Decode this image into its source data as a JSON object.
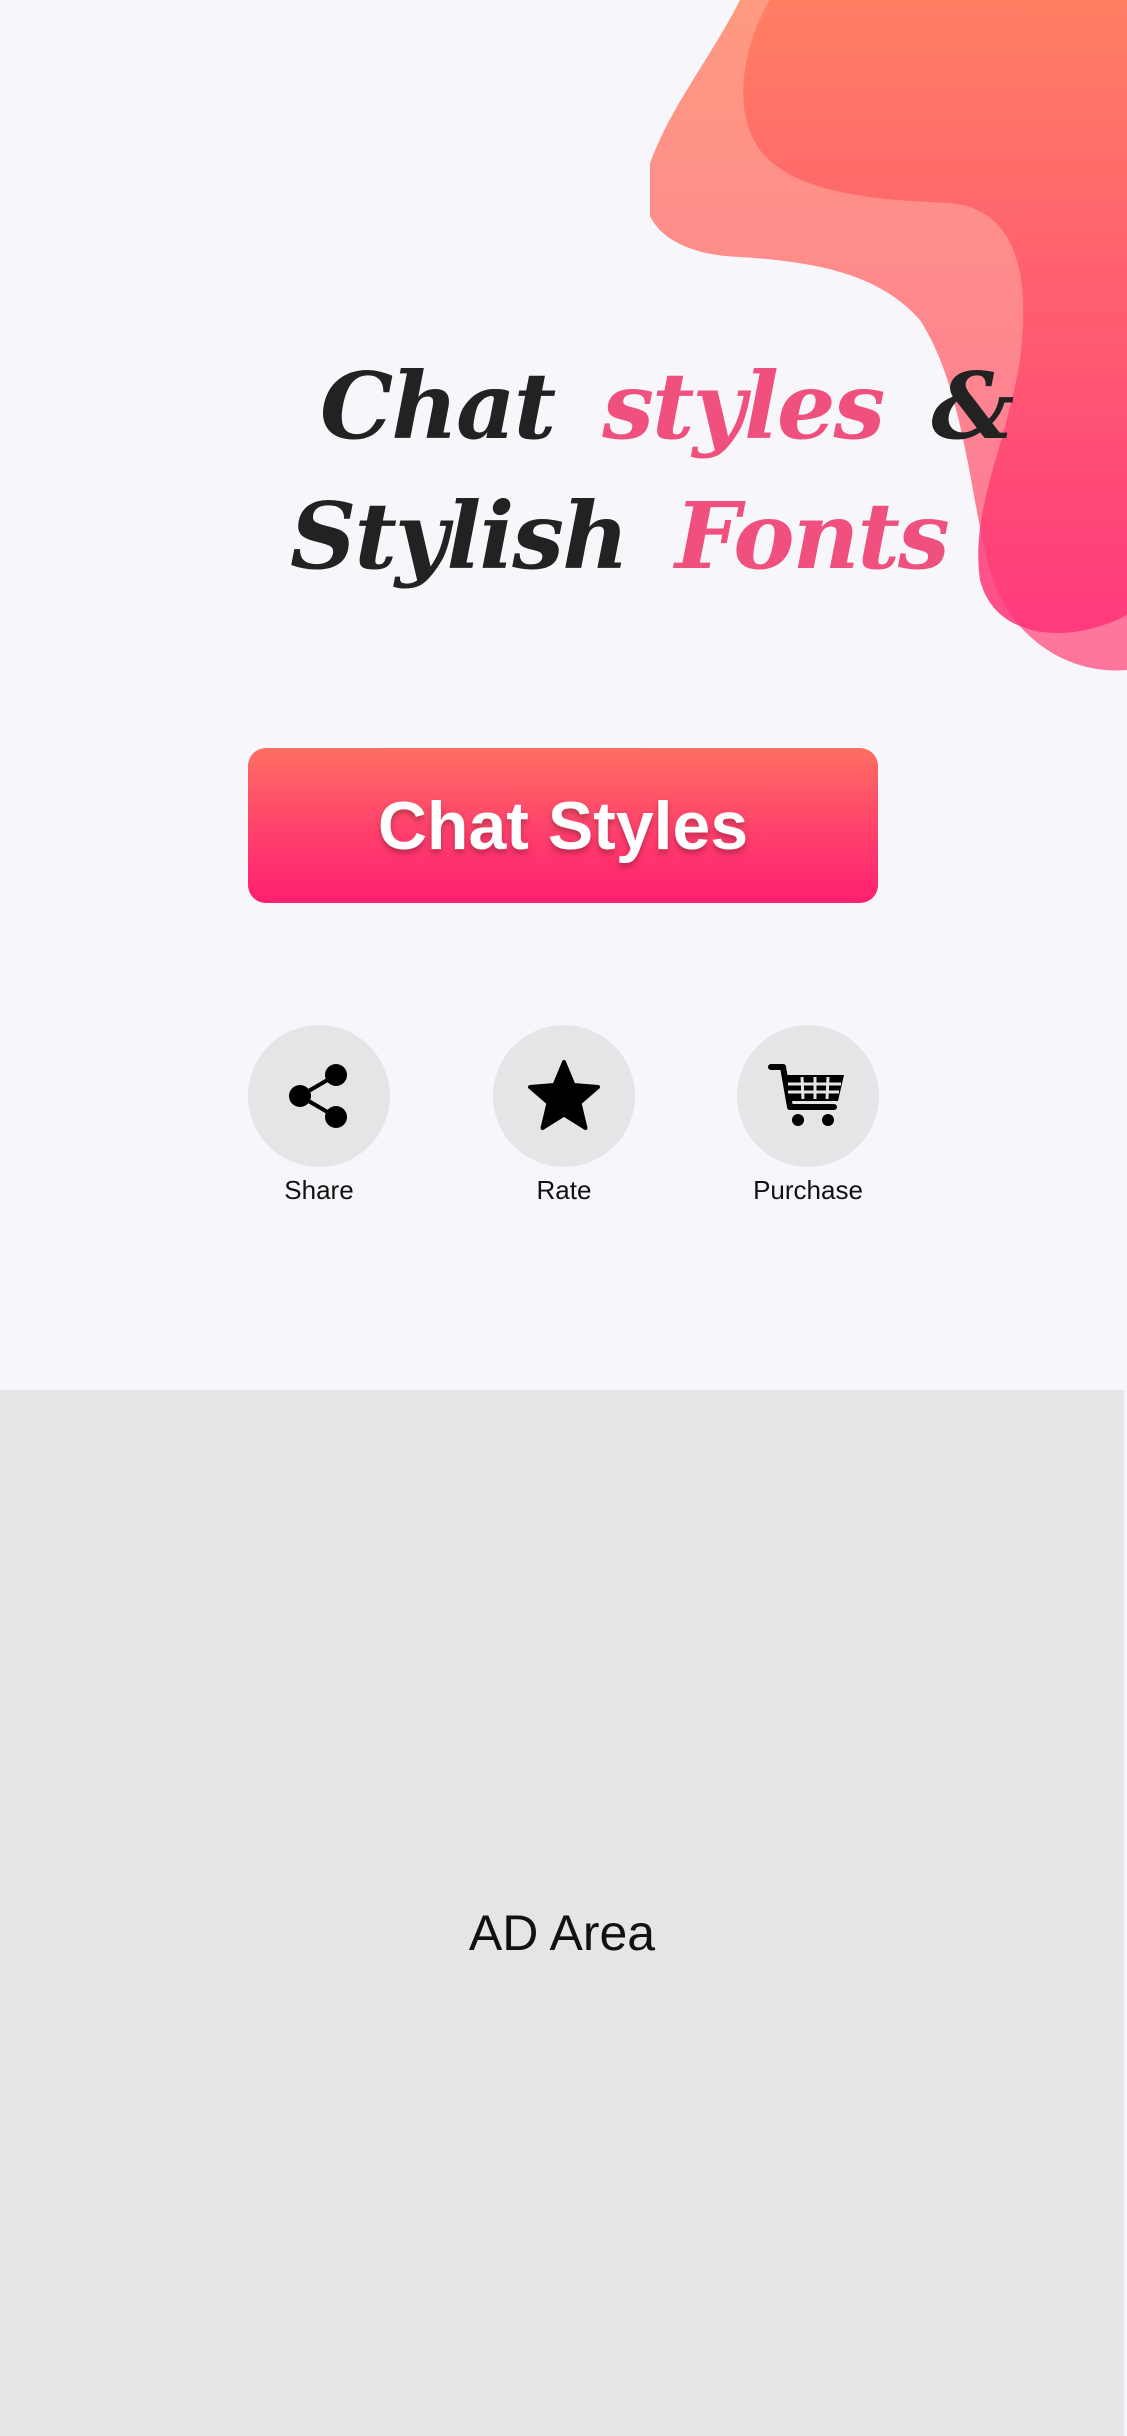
{
  "logo": {
    "line1": [
      "Chat",
      "styles",
      "&"
    ],
    "line2": [
      "Stylish",
      "Fonts"
    ]
  },
  "main_button": {
    "label": "Chat Styles"
  },
  "actions": [
    {
      "label": "Share",
      "icon": "share-icon"
    },
    {
      "label": "Rate",
      "icon": "star-icon"
    },
    {
      "label": "Purchase",
      "icon": "cart-icon"
    }
  ],
  "ad": {
    "label": "AD Area"
  },
  "colors": {
    "background": "#f7f7fb",
    "accent_top": "#ff6f61",
    "accent_bottom": "#ff1f70",
    "script_pink": "#f0507d",
    "ad_background": "#e5e5e5",
    "icon_circle": "#e5e5e7"
  }
}
